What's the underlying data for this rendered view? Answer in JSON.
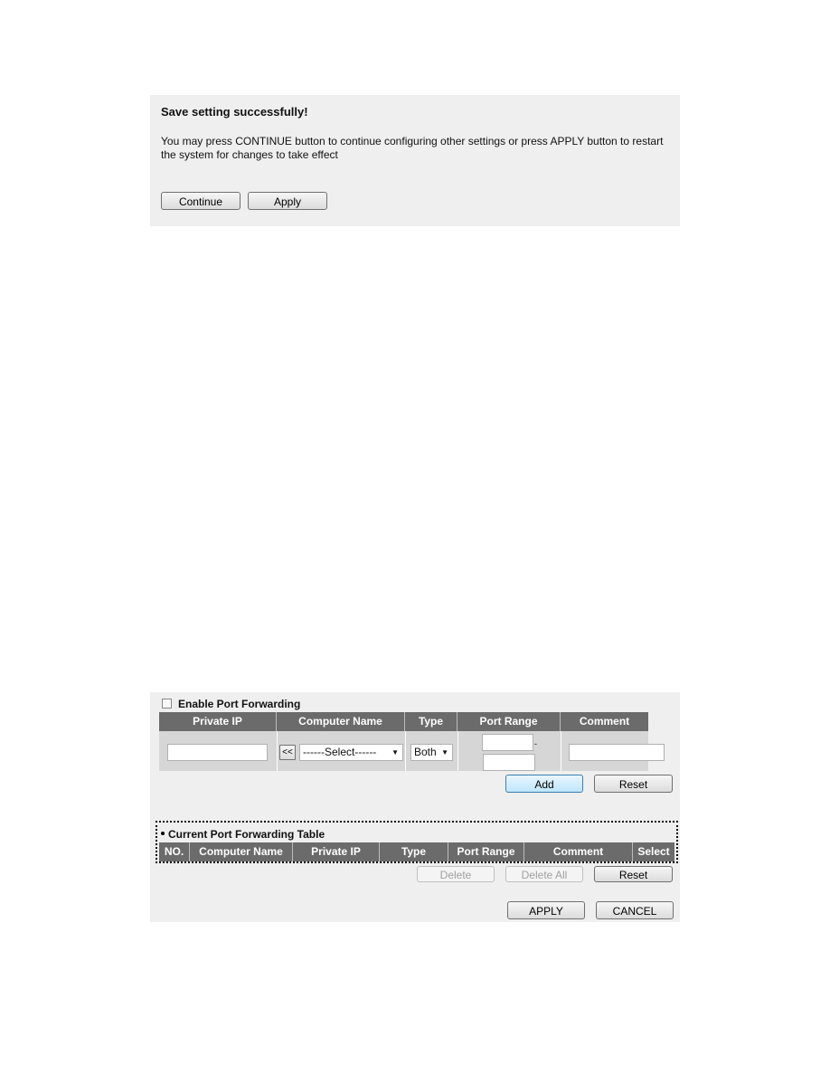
{
  "save_dialog": {
    "title": "Save setting successfully!",
    "message": "You may press CONTINUE button to continue configuring other settings or press APPLY button to restart the system for changes to take effect",
    "continue_label": "Continue",
    "apply_label": "Apply"
  },
  "port_forwarding": {
    "enable_label": "Enable Port Forwarding",
    "enabled": false,
    "columns": [
      "Private IP",
      "Computer Name",
      "Type",
      "Port Range",
      "Comment"
    ],
    "private_ip": "",
    "copy_button": "<<",
    "computer_select": "------Select------",
    "type_select": "Both",
    "port_from": "",
    "port_to": "",
    "port_separator": "-",
    "comment": "",
    "add_label": "Add",
    "reset_label": "Reset"
  },
  "current_table": {
    "title": "Current Port Forwarding Table",
    "columns": [
      "NO.",
      "Computer Name",
      "Private IP",
      "Type",
      "Port Range",
      "Comment",
      "Select"
    ],
    "delete_label": "Delete",
    "delete_all_label": "Delete All",
    "reset_label": "Reset"
  },
  "footer": {
    "apply_label": "APPLY",
    "cancel_label": "CANCEL"
  }
}
